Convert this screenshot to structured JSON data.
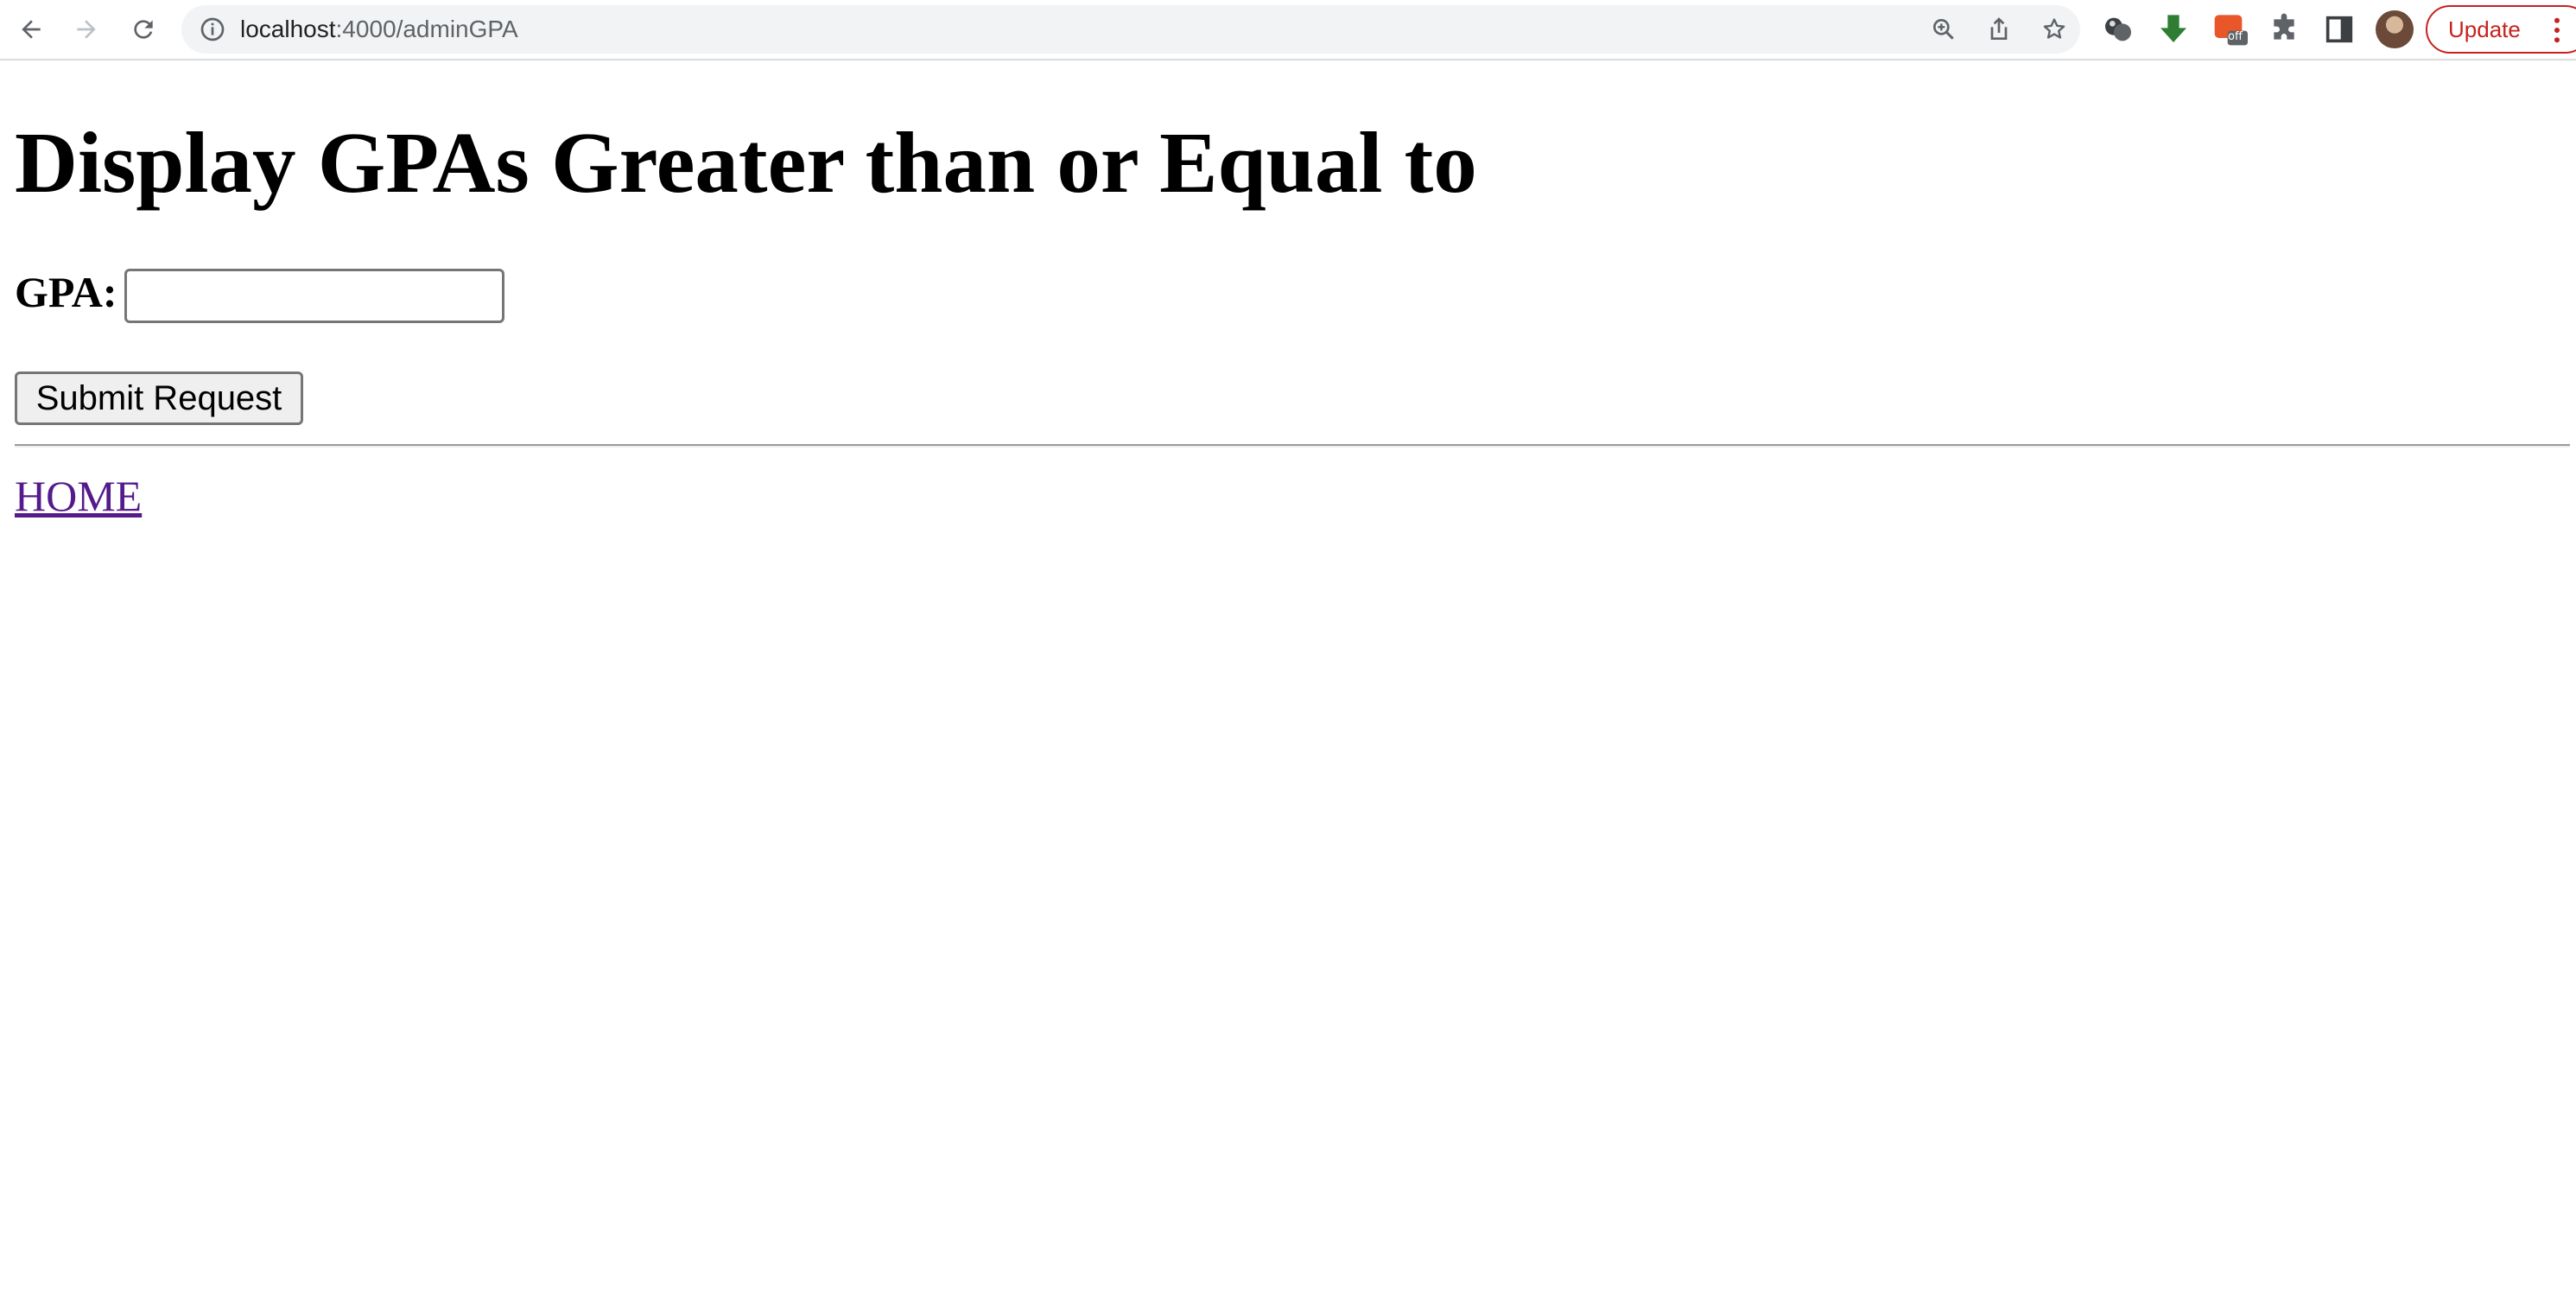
{
  "browser": {
    "url_host": "localhost",
    "url_path": ":4000/adminGPA",
    "update_label": "Update",
    "extension_badge": "off",
    "icons": [
      "back-icon",
      "forward-icon",
      "reload-icon",
      "site-info-icon",
      "zoom-icon",
      "share-icon",
      "bookmark-star-icon",
      "extension-balls-icon",
      "download-arrow-icon",
      "extension-off-icon",
      "extensions-puzzle-icon",
      "side-panel-icon",
      "profile-avatar",
      "more-vert-icon"
    ],
    "colors": {
      "update_accent": "#c5221f",
      "download_icon": "#2e7d32",
      "extension_badge": "#e8562a"
    }
  },
  "page": {
    "title": "Display GPAs Greater than or Equal to",
    "gpa_label": "GPA:",
    "gpa_input_value": "",
    "submit_label": "Submit Request",
    "home_link": "HOME",
    "link_color": "#551a8b"
  }
}
